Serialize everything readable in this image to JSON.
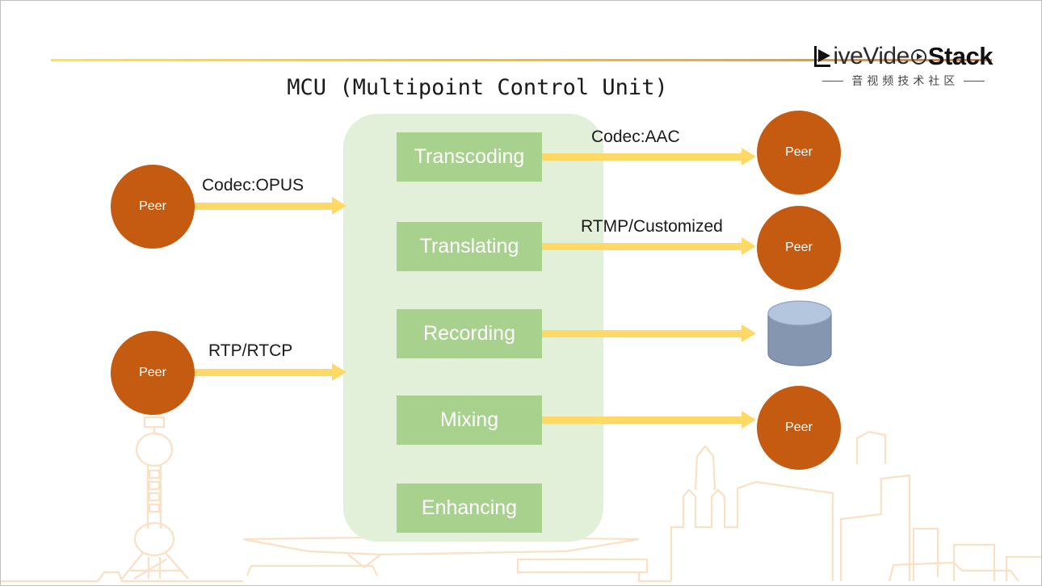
{
  "slide": {
    "title": "MCU (Multipoint Control Unit)"
  },
  "logo": {
    "icon": "livevideostack-play-logo",
    "text_light": "iveVide",
    "play_icon": "play-circle-icon",
    "text_bold": "Stack",
    "subtitle_cn": "音视频技术社区"
  },
  "mcu": {
    "container_name": "mcu-container",
    "processes": [
      {
        "label": "Transcoding"
      },
      {
        "label": "Translating"
      },
      {
        "label": "Recording"
      },
      {
        "label": "Mixing"
      },
      {
        "label": "Enhancing"
      }
    ]
  },
  "peers": {
    "input": [
      {
        "label": "Peer"
      },
      {
        "label": "Peer"
      }
    ],
    "output": [
      {
        "label": "Peer"
      },
      {
        "label": "Peer"
      },
      {
        "label": "Peer"
      }
    ]
  },
  "arrows": {
    "inputs": [
      {
        "label": "Codec:OPUS"
      },
      {
        "label": "RTP/RTCP"
      }
    ],
    "outputs": [
      {
        "label": "Codec:AAC"
      },
      {
        "label": "RTMP/Customized"
      },
      {
        "label": ""
      },
      {
        "label": ""
      }
    ]
  },
  "storage": {
    "icon": "database-cylinder-icon"
  },
  "colors": {
    "peer": "#C55A11",
    "process_box": "#A9D18E",
    "mcu_container": "#E2EFD9",
    "arrow": "#FFD966",
    "rule_start": "#FFE34D",
    "rule_end": "#E07B39",
    "db_body": "#8496B0",
    "db_top": "#B4C6DD",
    "skyline": "#FBE5D0"
  }
}
